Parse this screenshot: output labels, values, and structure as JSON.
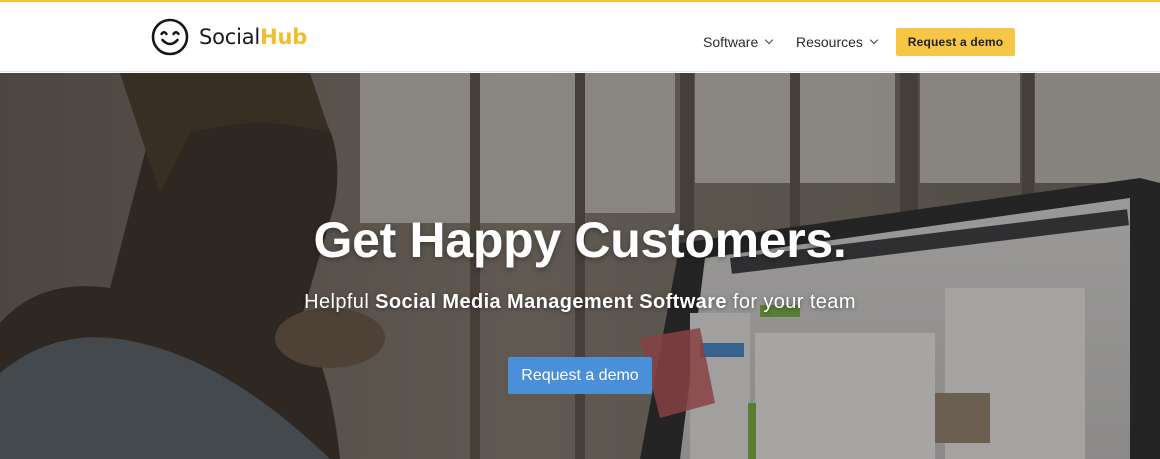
{
  "brand": {
    "name_part1": "Social",
    "name_part2": "Hub",
    "accent_color": "#f2bd2e",
    "logo_icon": "smiley-face-icon"
  },
  "nav": {
    "items": [
      {
        "label": "Software",
        "icon": "chevron-down-icon"
      },
      {
        "label": "Resources",
        "icon": "chevron-down-icon"
      }
    ],
    "cta_label": "Request a demo",
    "cta_color": "#f6c644"
  },
  "hero": {
    "headline": "Get Happy Customers.",
    "sub_prefix": "Helpful ",
    "sub_bold": "Social Media Management Software",
    "sub_suffix": " for your team",
    "cta_label": "Request a demo",
    "cta_color": "#4a90d9"
  }
}
